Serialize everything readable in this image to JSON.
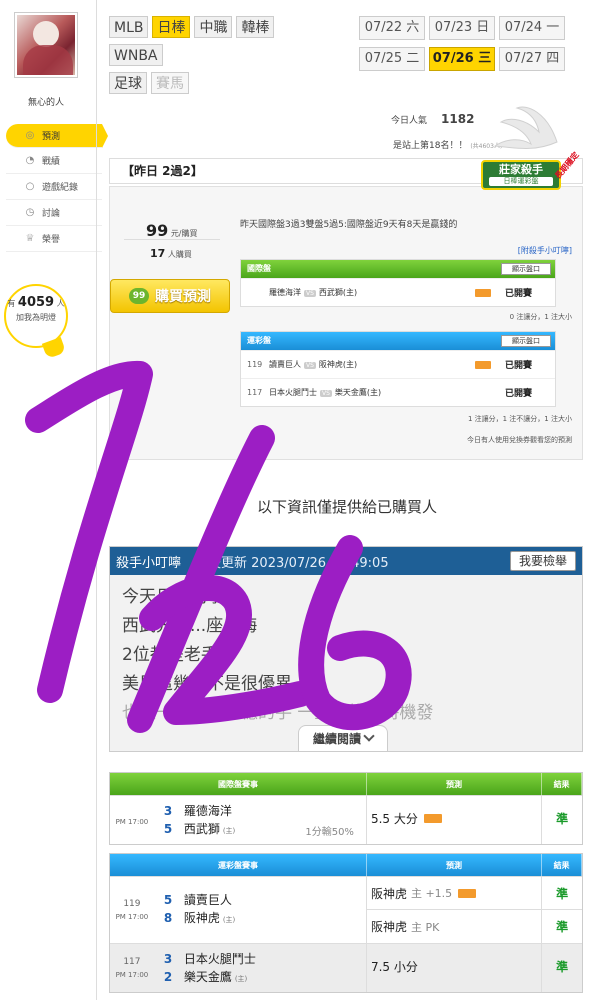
{
  "sidebar": {
    "username": "無心的人",
    "nav": [
      {
        "label": "預測",
        "icon": "target-icon",
        "active": true
      },
      {
        "label": "戰績",
        "icon": "chat-icon",
        "active": false
      },
      {
        "label": "遊戲紀錄",
        "icon": "circle-icon",
        "active": false
      },
      {
        "label": "討論",
        "icon": "clock-icon",
        "active": false
      },
      {
        "label": "榮譽",
        "icon": "trophy-icon",
        "active": false
      }
    ],
    "fans": {
      "prefix": "有",
      "count": "4059",
      "suffix": "人",
      "cta": "加我為明燈"
    }
  },
  "sports": {
    "row1": [
      "MLB",
      "日棒",
      "中職",
      "韓棒"
    ],
    "row2": [
      "WNBA"
    ],
    "row3": [
      "足球",
      "賽馬"
    ],
    "active": "日棒"
  },
  "dates": [
    {
      "label": "07/22 六",
      "active": false
    },
    {
      "label": "07/23 日",
      "active": false
    },
    {
      "label": "07/24 一",
      "active": false
    },
    {
      "label": "07/25 二",
      "active": false
    },
    {
      "label": "07/26 三",
      "active": true
    },
    {
      "label": "07/27 四",
      "active": false
    }
  ],
  "stats": {
    "popularity_label": "今日人氣",
    "popularity_value": "1182",
    "rank_text": "是站上第18名！！",
    "rank_small": "(共4603人)"
  },
  "badge": {
    "title": "莊家殺手",
    "sub": "日棒運彩盤",
    "star": "長期穩定"
  },
  "yesterday": {
    "label": "【昨日 2過2】"
  },
  "prediction": {
    "price_value": "99",
    "price_unit": "元/購買",
    "buyers_value": "17",
    "buyers_unit": "人購買",
    "buy_button": "購買預測",
    "buy_tag": "99",
    "summary": "昨天國際盤3過3雙盤5過5:國際盤近9天有8天是贏錢的",
    "tip_link": "[附殺手小叮嚀]",
    "intl": {
      "title": "國際盤",
      "show_btn": "顯示盤口",
      "games": [
        {
          "num": "",
          "away": "羅德海洋",
          "vs": "VS",
          "home": "西武獅(主)",
          "state": "已開賽"
        }
      ],
      "footer": "0 注讓分，1 注大小"
    },
    "lottery": {
      "title": "運彩盤",
      "show_btn": "顯示盤口",
      "games": [
        {
          "num": "119",
          "away": "讀賣巨人",
          "vs": "VS",
          "home": "阪神虎(主)",
          "state": "已開賽",
          "tag": true
        },
        {
          "num": "117",
          "away": "日本火腿鬥士",
          "vs": "VS",
          "home": "樂天金鷹(主)",
          "state": "已開賽",
          "tag": false
        }
      ],
      "footer": "1 注讓分，1 注不讓分，1 注大小",
      "footer2": "今日有人使用兌換券觀看您的預測"
    }
  },
  "notice": "以下資訊僅提供給已購買人",
  "blog": {
    "title": "殺手小叮嚀",
    "updated": "最後更新 2023/07/26 19:49:05",
    "report": "我要檢舉",
    "lines": [
      "今天日本馬學",
      "西武先發...座人海",
      "2位都是老手了",
      "美馬這幾年不是很優異",
      "也是一海控球不穩的手 一直想找到時機發"
    ],
    "read_more": "繼續閱讀"
  },
  "intl_results": {
    "headers": [
      "國際盤賽事",
      "預測",
      "結果"
    ],
    "rows": [
      {
        "time": "PM 17:00",
        "num": "",
        "teams": [
          {
            "score": "3",
            "name": "羅德海洋",
            "home": ""
          },
          {
            "score": "5",
            "name": "西武獅",
            "home": "(主)"
          }
        ],
        "note": "1分輸50%",
        "preds": [
          {
            "text": "5.5 大分",
            "side": "",
            "tag": true
          }
        ],
        "results": [
          "準"
        ]
      }
    ]
  },
  "lottery_results": {
    "headers": [
      "運彩盤賽事",
      "預測",
      "結果"
    ],
    "rows": [
      {
        "time": "PM 17:00",
        "num": "119",
        "teams": [
          {
            "score": "5",
            "name": "讀賣巨人",
            "home": ""
          },
          {
            "score": "8",
            "name": "阪神虎",
            "home": "(主)"
          }
        ],
        "note": "",
        "preds": [
          {
            "text": "阪神虎",
            "side": "主 +1.5",
            "tag": true
          },
          {
            "text": "阪神虎",
            "side": "主 PK",
            "tag": false
          }
        ],
        "results": [
          "準",
          "準"
        ]
      },
      {
        "time": "PM 17:00",
        "num": "117",
        "teams": [
          {
            "score": "3",
            "name": "日本火腿鬥士",
            "home": ""
          },
          {
            "score": "2",
            "name": "樂天金鷹",
            "home": "(主)"
          }
        ],
        "note": "",
        "preds": [
          {
            "text": "7.5 小分",
            "side": "",
            "tag": false
          }
        ],
        "results": [
          "準"
        ]
      }
    ]
  },
  "overlay": {
    "handwriting": "7/26",
    "color": "#9c1ec4"
  }
}
